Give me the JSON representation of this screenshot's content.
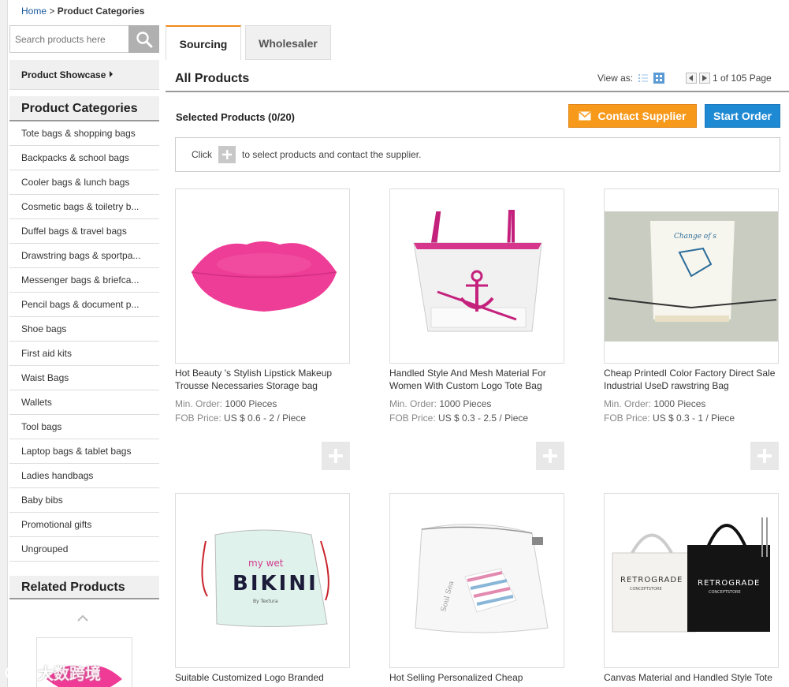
{
  "breadcrumb": {
    "home": "Home",
    "sep": ">",
    "current": "Product Categories"
  },
  "search": {
    "placeholder": "Search products here"
  },
  "sidebar": {
    "showcase": "Product Showcase",
    "categories_title": "Product Categories",
    "categories": [
      "Tote bags & shopping bags",
      "Backpacks & school bags",
      "Cooler bags & lunch bags",
      "Cosmetic bags & toiletry b...",
      "Duffel bags & travel bags",
      "Drawstring bags & sportpa...",
      "Messenger bags & briefca...",
      "Pencil bags & document p...",
      "Shoe bags",
      "First aid kits",
      "Waist Bags",
      "Wallets",
      "Tool bags",
      "Laptop bags & tablet bags",
      "Ladies handbags",
      "Baby bibs",
      "Promotional gifts",
      "Ungrouped"
    ],
    "related_title": "Related Products"
  },
  "watermark": "大数跨境",
  "tabs": {
    "sourcing": "Sourcing",
    "wholesaler": "Wholesaler"
  },
  "main": {
    "title": "All Products",
    "view_as": "View as:",
    "pager": "1 of 105 Page",
    "selected": "Selected Products (0/20)",
    "contact_label": "Contact Supplier",
    "order_label": "Start Order",
    "hint_click": "Click",
    "hint_rest": "to select products and contact the supplier."
  },
  "labels": {
    "min_order": "Min. Order:",
    "fob_price": "FOB Price:"
  },
  "products": [
    {
      "title": "Hot Beauty 's Stylish Lipstick Makeup Trousse Necessaries Storage bag",
      "min_order": "1000 Pieces",
      "fob": "US $ 0.6 - 2 / Piece"
    },
    {
      "title": "Handled Style And Mesh Material For Women With Custom Logo Tote Bag",
      "min_order": "1000 Pieces",
      "fob": "US $ 0.3 - 2.5 / Piece"
    },
    {
      "title": "Cheap PrintedI Color Factory Direct Sale Industrial UseD rawstring Bag",
      "min_order": "1000 Pieces",
      "fob": "US $ 0.3 - 1 / Piece"
    },
    {
      "title": "Suitable Customized Logo Branded",
      "img_text_top": "my wet",
      "img_text_main": "BIKINI",
      "img_text_sub": "By Textura"
    },
    {
      "title": "Hot Selling Personalized Cheap"
    },
    {
      "title": "Canvas Material and Handled Style Tote",
      "img_brand": "RETROGRADE",
      "img_brand_sub": "CONCEPTSTORE"
    }
  ],
  "colors": {
    "accent_orange": "#f79a1c",
    "accent_blue": "#1f8ad4",
    "tab_active": "#f28a1a",
    "link": "#1a5a9c"
  }
}
